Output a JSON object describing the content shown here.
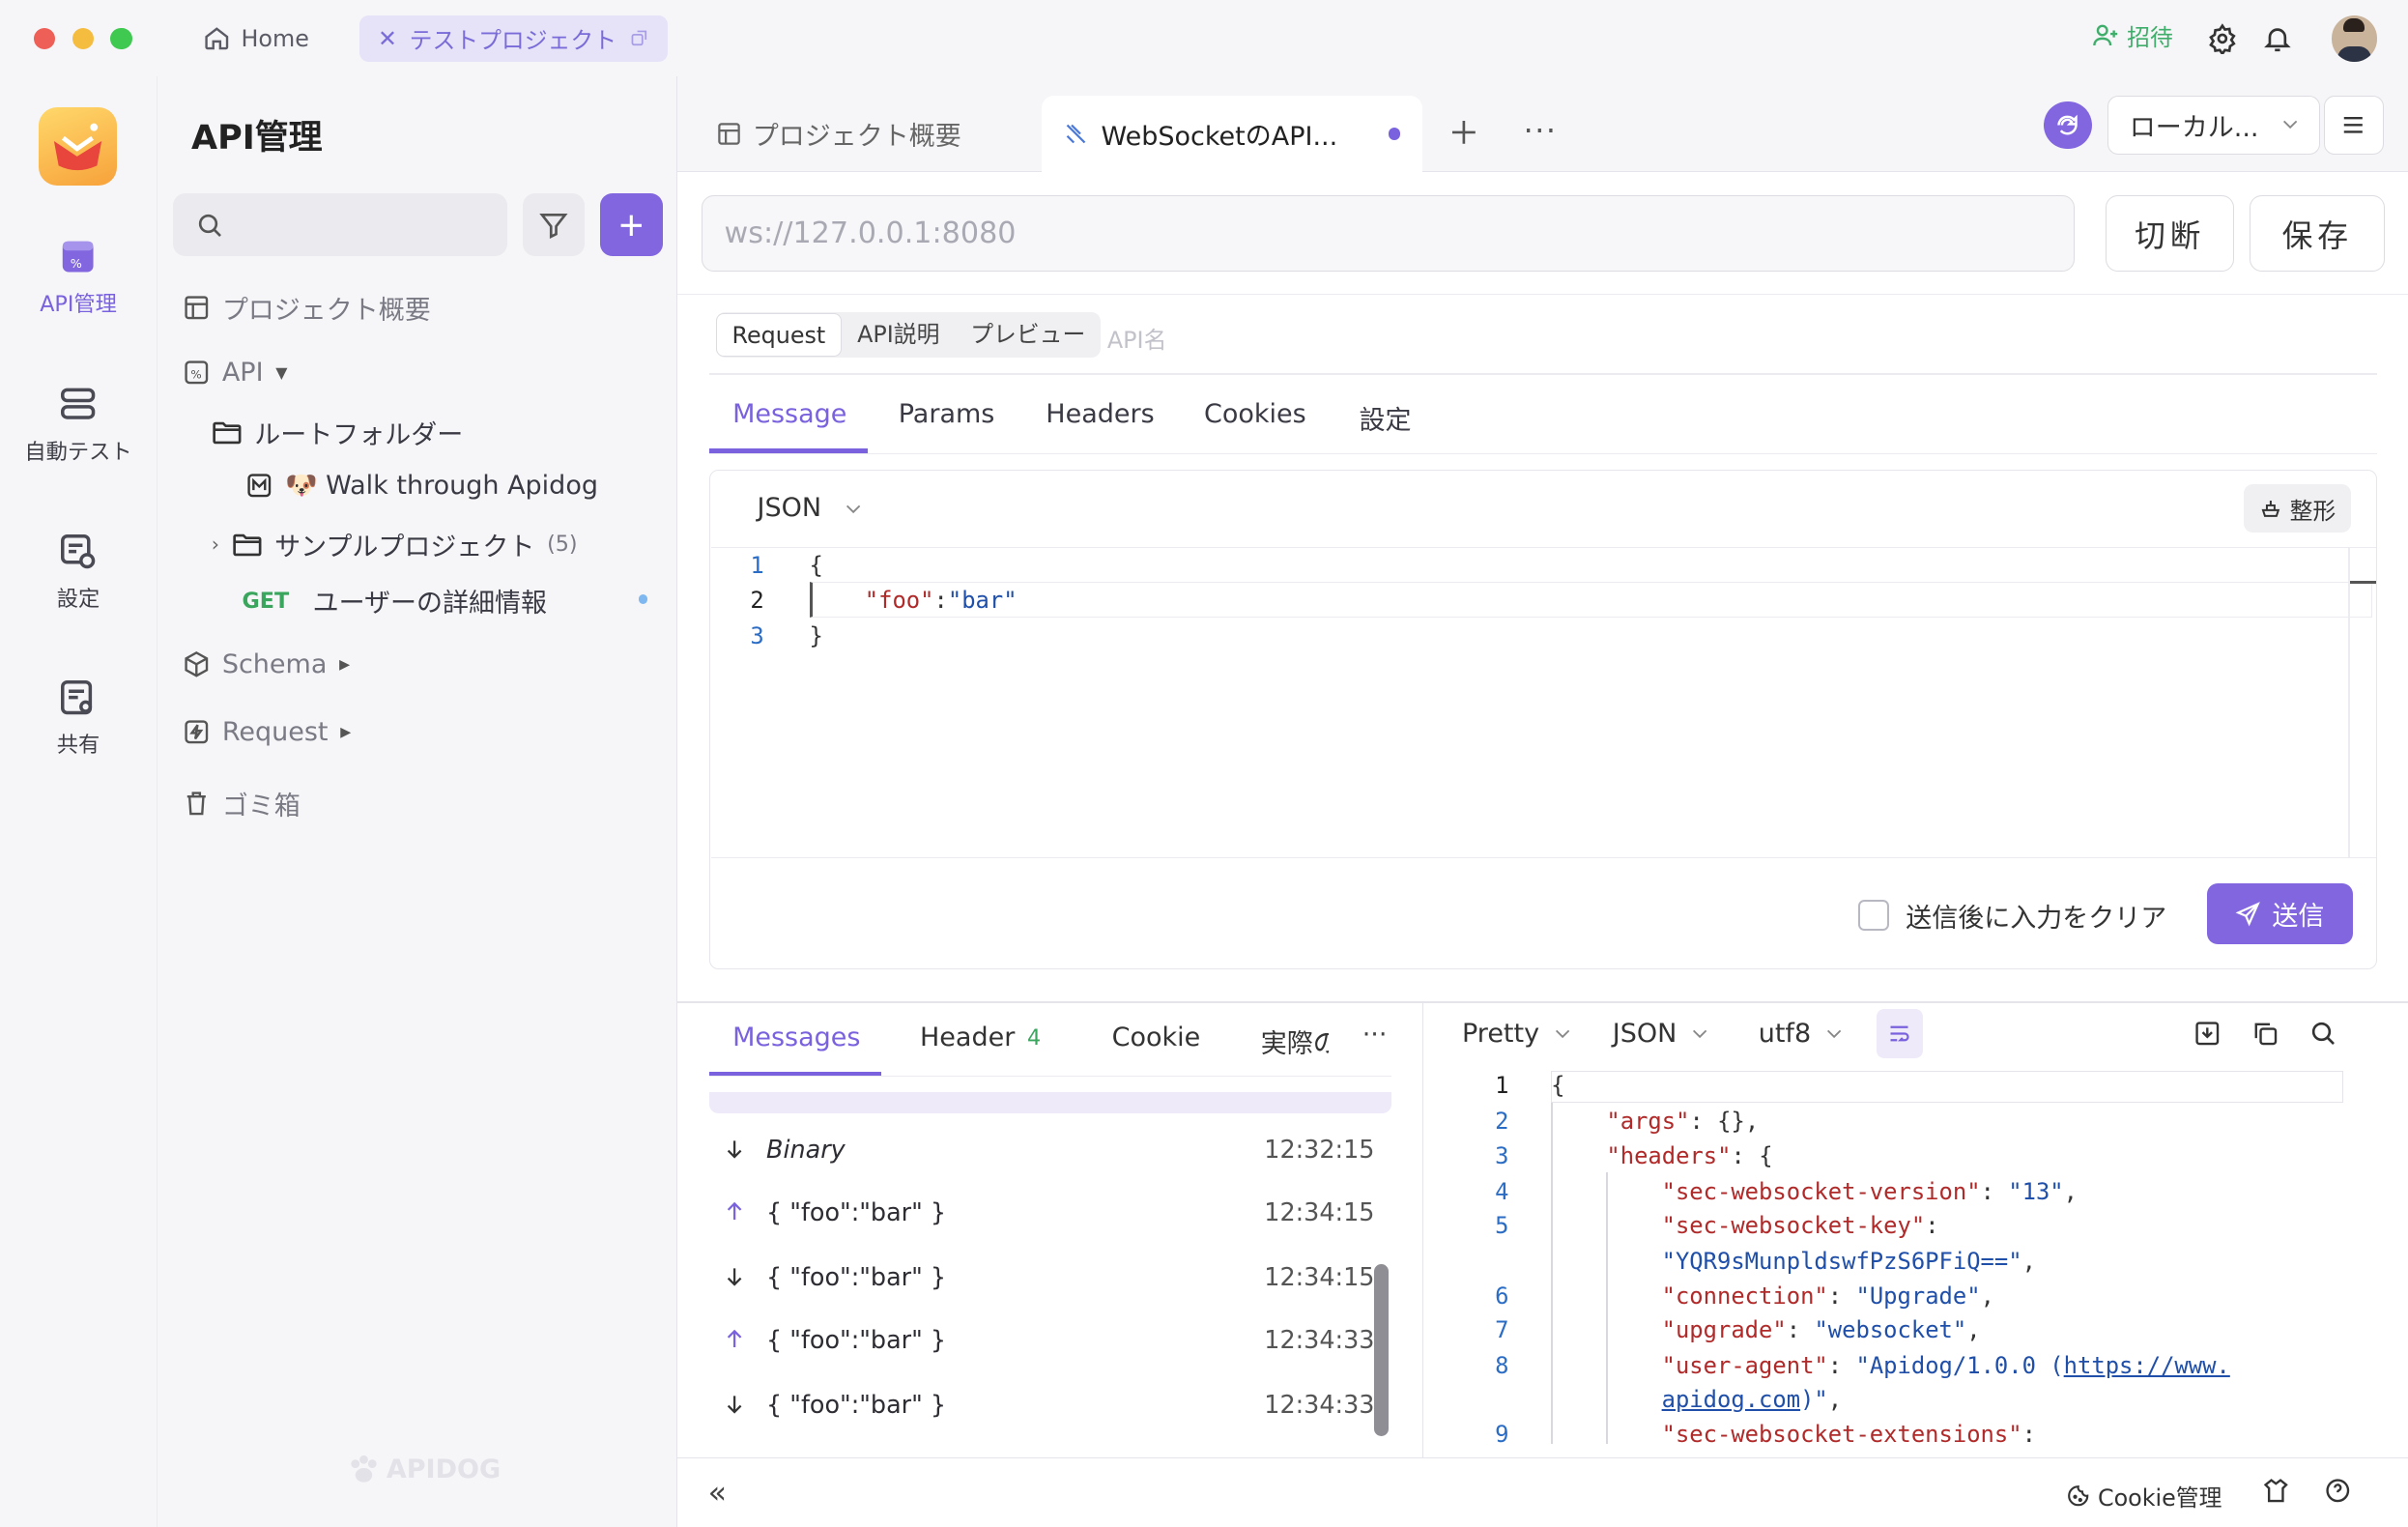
{
  "titlebar": {
    "home_label": "Home",
    "project_tab": "テストプロジェクト",
    "invite_label": "招待"
  },
  "leftnav": {
    "items": [
      {
        "label": "API管理",
        "icon": "api-icon",
        "active": true
      },
      {
        "label": "自動テスト",
        "icon": "autotest-icon"
      },
      {
        "label": "設定",
        "icon": "settings-icon"
      },
      {
        "label": "共有",
        "icon": "share-icon"
      }
    ]
  },
  "sidebar": {
    "title": "API管理",
    "project_overview": "プロジェクト概要",
    "api_label": "API",
    "root_folder": "ルートフォルダー",
    "walk_doc": "🐶 Walk through Apidog",
    "sample_project": "サンプルプロジェクト",
    "sample_count": "(5)",
    "get_method": "GET",
    "get_label": "ユーザーの詳細情報",
    "schema": "Schema",
    "request": "Request",
    "trash": "ゴミ箱",
    "watermark": "APIDOG"
  },
  "tabs": {
    "overview": "プロジェクト概要",
    "active": "WebSocketのAPI...",
    "environment": "ローカル..."
  },
  "request": {
    "url_placeholder": "ws://127.0.0.1:8080",
    "disconnect": "切断",
    "save": "保存",
    "seg_request": "Request",
    "seg_doc": "API説明",
    "seg_preview": "プレビュー",
    "api_name_placeholder": "API名",
    "param_tabs": [
      "Message",
      "Params",
      "Headers",
      "Cookies",
      "設定"
    ],
    "format": "JSON",
    "beautify": "整形",
    "code_lines": [
      "1",
      "2",
      "3"
    ],
    "code_open": "{",
    "code_key": "\"foo\"",
    "code_colon": ":",
    "code_value": "\"bar\"",
    "code_close": "}",
    "clear_after_send": "送信後に入力をクリア",
    "send": "送信"
  },
  "messages": {
    "tabs": {
      "messages": "Messages",
      "header": "Header",
      "header_count": "4",
      "cookie": "Cookie",
      "actual": "実際の"
    },
    "items": [
      {
        "dir": "down",
        "text": "Binary",
        "time": "12:32:15"
      },
      {
        "dir": "up",
        "text": "{ \"foo\":\"bar\" }",
        "time": "12:34:15"
      },
      {
        "dir": "down",
        "text": "{ \"foo\":\"bar\" }",
        "time": "12:34:15"
      },
      {
        "dir": "up",
        "text": "{ \"foo\":\"bar\" }",
        "time": "12:34:33"
      },
      {
        "dir": "down",
        "text": "{ \"foo\":\"bar\" }",
        "time": "12:34:33"
      }
    ]
  },
  "response": {
    "view": "Pretty",
    "format": "JSON",
    "encoding": "utf8",
    "line_numbers": [
      "1",
      "2",
      "3",
      "4",
      "5",
      "6",
      "7",
      "8",
      "9"
    ],
    "l1": "{",
    "l2_key": "\"args\"",
    "l2_rest": ": {},",
    "l3_key": "\"headers\"",
    "l3_rest": ": {",
    "l4_key": "\"sec-websocket-version\"",
    "l4_val": "\"13\"",
    "l5_key": "\"sec-websocket-key\"",
    "l5_val": "\"YQR9sMunpldswfPzS6PFiQ==\"",
    "l6_key": "\"connection\"",
    "l6_val": "\"Upgrade\"",
    "l7_key": "\"upgrade\"",
    "l7_val": "\"websocket\"",
    "l8_key": "\"user-agent\"",
    "l8_val_a": "\"Apidog/1.0.0 (",
    "l8_link_a": "https://www.",
    "l8_link_b": "apidog.com",
    "l8_val_b": ")\"",
    "l9_key": "\"sec-websocket-extensions\""
  },
  "footer": {
    "cookie_manage": "Cookie管理"
  },
  "colors": {
    "accent": "#8266e0",
    "get_green": "#3aa55d",
    "json_key": "#b02a2a",
    "json_value": "#1f4fa8"
  }
}
